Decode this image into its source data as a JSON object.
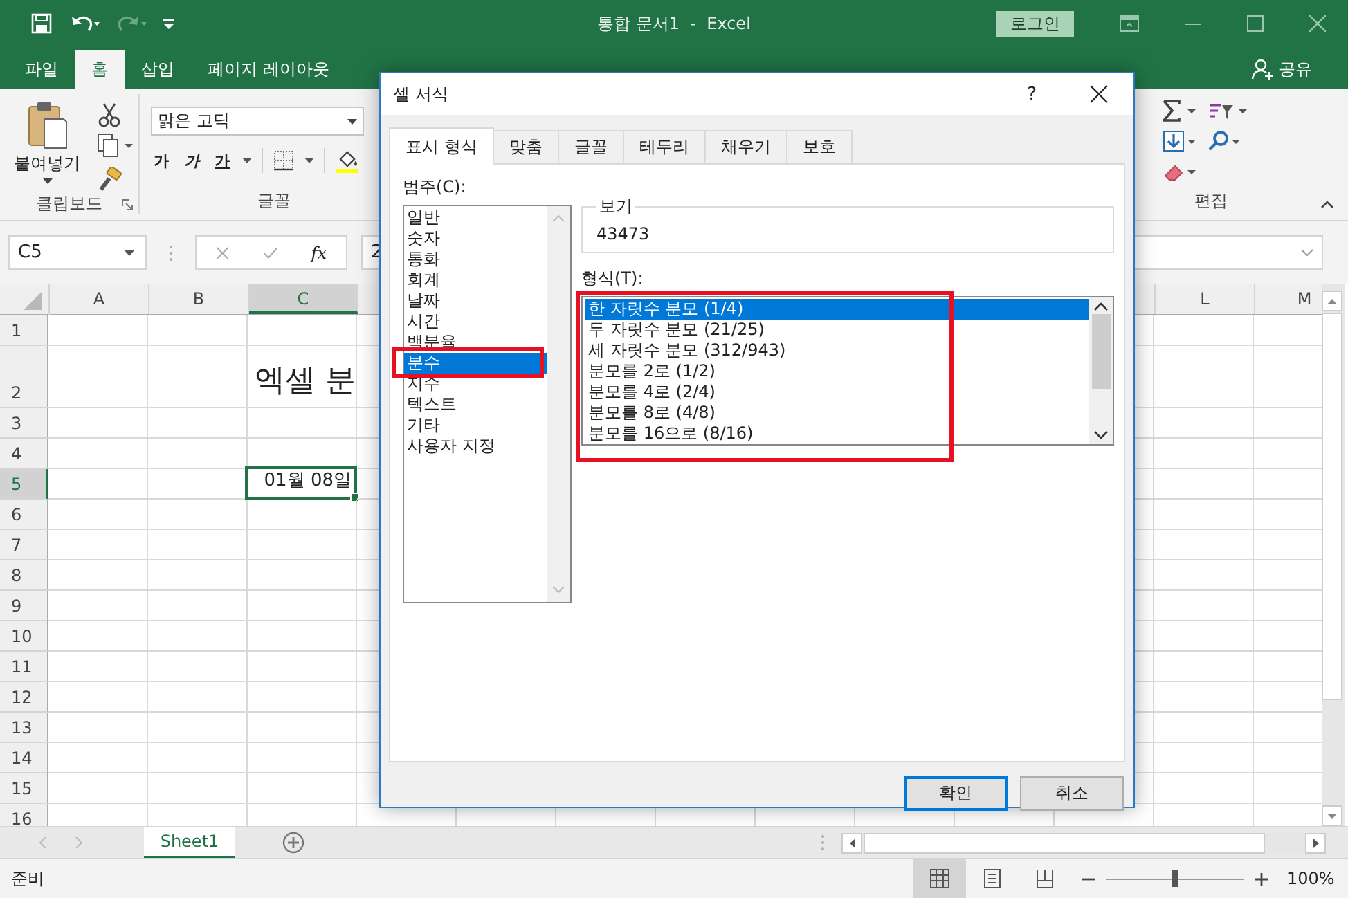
{
  "title_bar": {
    "title": "통합 문서1  -  Excel",
    "login": "로그인"
  },
  "ribbon_tabs": [
    {
      "label": "파일",
      "selected": false
    },
    {
      "label": "홈",
      "selected": true
    },
    {
      "label": "삽입",
      "selected": false
    },
    {
      "label": "페이지 레이아웃",
      "selected": false
    }
  ],
  "share": "공유",
  "ribbon": {
    "clipboard": {
      "paste": "붙여넣기",
      "label": "클립보드"
    },
    "font": {
      "font_name": "맑은 고딕",
      "bold": "가",
      "italic": "가",
      "underline": "가",
      "label": "글꼴"
    },
    "editing": {
      "label": "편집"
    }
  },
  "formula_bar": {
    "name_box": "C5",
    "function_label": "fx",
    "value": "2"
  },
  "sheet": {
    "columns": [
      {
        "label": "A",
        "selected": false
      },
      {
        "label": "B",
        "selected": false
      },
      {
        "label": "C",
        "selected": true
      },
      {
        "label": "L",
        "selected": false
      },
      {
        "label": "M",
        "selected": false
      }
    ],
    "rows": [
      {
        "label": "1",
        "selected": false
      },
      {
        "label": "2",
        "selected": false
      },
      {
        "label": "3",
        "selected": false
      },
      {
        "label": "4",
        "selected": false
      },
      {
        "label": "5",
        "selected": true
      },
      {
        "label": "6",
        "selected": false
      },
      {
        "label": "7",
        "selected": false
      },
      {
        "label": "8",
        "selected": false
      },
      {
        "label": "9",
        "selected": false
      },
      {
        "label": "10",
        "selected": false
      },
      {
        "label": "11",
        "selected": false
      },
      {
        "label": "12",
        "selected": false
      },
      {
        "label": "13",
        "selected": false
      },
      {
        "label": "14",
        "selected": false
      },
      {
        "label": "15",
        "selected": false
      },
      {
        "label": "16",
        "selected": false
      }
    ],
    "title_cell": "엑셀 분",
    "active_cell": "01월 08일",
    "tabs": [
      {
        "label": "Sheet1",
        "selected": true
      }
    ]
  },
  "status_bar": {
    "text": "준비",
    "views": [
      {
        "kind": "normal",
        "selected": true
      },
      {
        "kind": "page_layout",
        "selected": false
      },
      {
        "kind": "page_break",
        "selected": false
      }
    ],
    "zoom": {
      "level": 0.5,
      "reading": "100%"
    }
  },
  "dialog": {
    "title": "셀 서식",
    "help": "?",
    "tabs": [
      {
        "label": "표시 형식",
        "selected": true
      },
      {
        "label": "맞춤",
        "selected": false
      },
      {
        "label": "글꼴",
        "selected": false
      },
      {
        "label": "테두리",
        "selected": false
      },
      {
        "label": "채우기",
        "selected": false
      },
      {
        "label": "보호",
        "selected": false
      }
    ],
    "category_label": "범주(C):",
    "categories": [
      {
        "label": "일반",
        "selected": false,
        "highlighted": false
      },
      {
        "label": "숫자",
        "selected": false,
        "highlighted": false
      },
      {
        "label": "통화",
        "selected": false,
        "highlighted": false
      },
      {
        "label": "회계",
        "selected": false,
        "highlighted": false
      },
      {
        "label": "날짜",
        "selected": false,
        "highlighted": false
      },
      {
        "label": "시간",
        "selected": false,
        "highlighted": false
      },
      {
        "label": "백분율",
        "selected": false,
        "highlighted": false
      },
      {
        "label": "분수",
        "selected": true,
        "highlighted": true
      },
      {
        "label": "지수",
        "selected": false,
        "highlighted": false
      },
      {
        "label": "텍스트",
        "selected": false,
        "highlighted": false
      },
      {
        "label": "기타",
        "selected": false,
        "highlighted": false
      },
      {
        "label": "사용자 지정",
        "selected": false,
        "highlighted": false
      }
    ],
    "sample_label": "보기",
    "sample": "43473",
    "type_label": "형식(T):",
    "types_highlighted": true,
    "types": [
      {
        "label": "한 자릿수 분모 (1/4)",
        "selected": true
      },
      {
        "label": "두 자릿수 분모 (21/25)",
        "selected": false
      },
      {
        "label": "세 자릿수 분모 (312/943)",
        "selected": false
      },
      {
        "label": "분모를 2로 (1/2)",
        "selected": false
      },
      {
        "label": "분모를 4로 (2/4)",
        "selected": false
      },
      {
        "label": "분모를 8로 (4/8)",
        "selected": false
      },
      {
        "label": "분모를 16으로 (8/16)",
        "selected": false
      }
    ],
    "buttons": [
      {
        "label": "확인",
        "default": true
      },
      {
        "label": "취소",
        "default": false
      }
    ]
  }
}
